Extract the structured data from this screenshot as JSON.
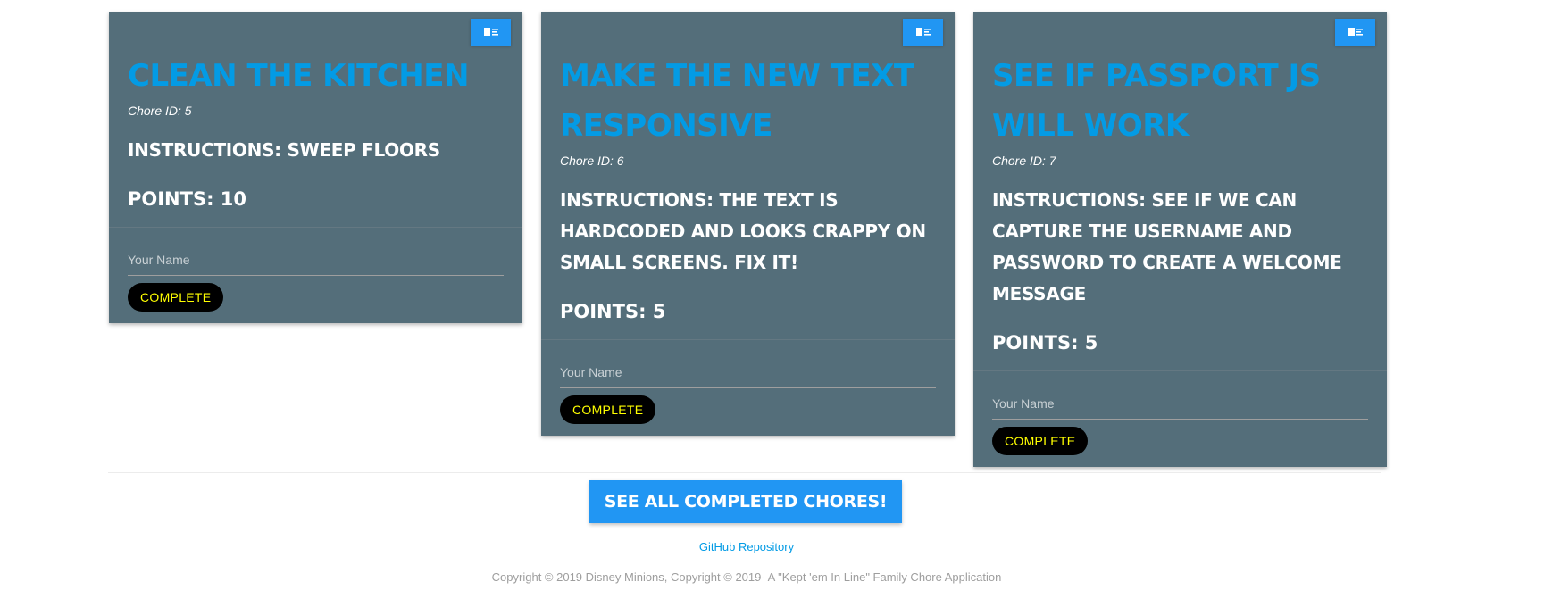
{
  "chores": [
    {
      "title": "Clean the Kitchen",
      "chore_id": "Chore ID: 5",
      "instructions": "Instructions: Sweep Floors",
      "points": "Points: 10",
      "name_placeholder": "Your Name",
      "complete_label": "COMPLETE",
      "menu_icon": "delete-list-icon"
    },
    {
      "title": "Make the new text responsive",
      "chore_id": "Chore ID: 6",
      "instructions": "Instructions: The text is hardcoded and looks crappy on small screens. Fix it!",
      "points": "Points: 5",
      "name_placeholder": "Your Name",
      "complete_label": "COMPLETE",
      "menu_icon": "delete-list-icon"
    },
    {
      "title": "See if Passport JS will work",
      "chore_id": "Chore ID: 7",
      "instructions": "Instructions: See if we can capture the username and password to create a welcome message",
      "points": "Points: 5",
      "name_placeholder": "Your Name",
      "complete_label": "COMPLETE",
      "menu_icon": "delete-list-icon"
    }
  ],
  "footer": {
    "see_all_label": "See All Completed Chores!",
    "github_link": "GitHub Repository",
    "copyright": "Copyright © 2019 Disney Minions, Copyright © 2019- A \"Kept 'em In Line\" Family Chore Application"
  },
  "colors": {
    "card_bg": "#546e7a",
    "accent_blue": "#2196f3",
    "title_blue": "#039be5",
    "complete_text": "#ffff00"
  }
}
